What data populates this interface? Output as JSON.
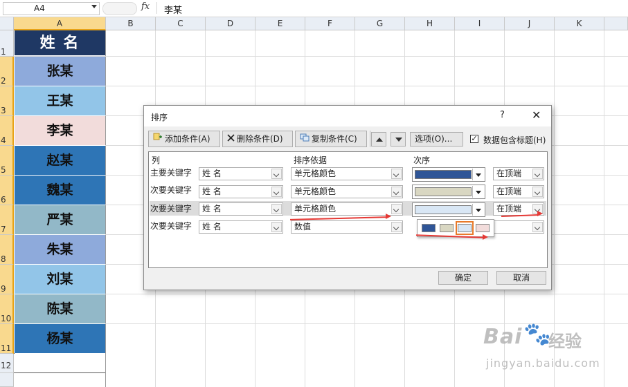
{
  "formula_bar": {
    "name_box": "A4",
    "fx": "fx",
    "content": "李某"
  },
  "columns": [
    "A",
    "B",
    "C",
    "D",
    "E",
    "F",
    "G",
    "H",
    "I",
    "J",
    "K"
  ],
  "rows": [
    "1",
    "2",
    "3",
    "4",
    "5",
    "6",
    "7",
    "8",
    "9",
    "10",
    "11",
    "12"
  ],
  "cells": [
    {
      "text": "姓 名",
      "color": "#1f3864"
    },
    {
      "text": "张某",
      "color": "#8eaadb"
    },
    {
      "text": "王某",
      "color": "#92c5e8"
    },
    {
      "text": "李某",
      "color": "#f2dcdb"
    },
    {
      "text": "赵某",
      "color": "#2e75b6"
    },
    {
      "text": "魏某",
      "color": "#2e75b6"
    },
    {
      "text": "严某",
      "color": "#92b8c8"
    },
    {
      "text": "朱某",
      "color": "#8eaadb"
    },
    {
      "text": "刘某",
      "color": "#92c5e8"
    },
    {
      "text": "陈某",
      "color": "#92b8c8"
    },
    {
      "text": "杨某",
      "color": "#2e75b6"
    }
  ],
  "dialog": {
    "title": "排序",
    "help": "?",
    "close": "✕",
    "toolbar": {
      "add": "添加条件(A)",
      "delete": "删除条件(D)",
      "copy": "复制条件(C)",
      "options": "选项(O)...",
      "has_header_label": "数据包含标题(H)",
      "has_header": true
    },
    "headers": {
      "column": "列",
      "sort_on": "排序依据",
      "order": "次序"
    },
    "rules": [
      {
        "label": "主要关键字",
        "column": "姓  名",
        "sort_on": "单元格颜色",
        "order_color": "#2f5597",
        "position": "在顶端"
      },
      {
        "label": "次要关键字",
        "column": "姓  名",
        "sort_on": "单元格颜色",
        "order_color": "#d9d7c2",
        "position": "在顶端"
      },
      {
        "label": "次要关键字",
        "column": "姓  名",
        "sort_on": "单元格颜色",
        "order_color": "#d9e7f5",
        "position": "在顶端"
      },
      {
        "label": "次要关键字",
        "column": "姓  名",
        "sort_on": "数值",
        "order_color": "",
        "position": ""
      }
    ],
    "color_options": [
      "#2f5597",
      "#d9d7c2",
      "#d9e7f5",
      "#f2dcdb"
    ],
    "ok": "确定",
    "cancel": "取消"
  },
  "watermark": {
    "brand_a": "Bai",
    "brand_b": "经验",
    "url": "jingyan.baidu.com"
  }
}
